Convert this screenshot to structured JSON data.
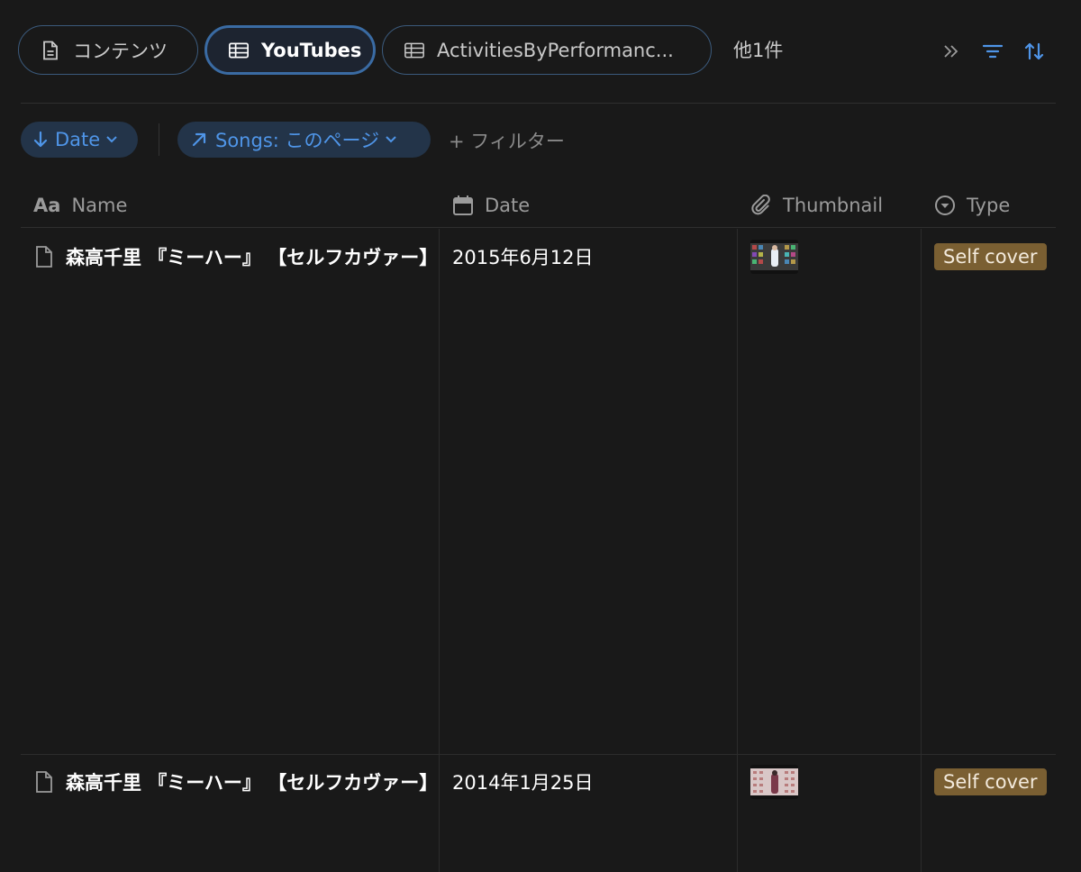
{
  "tabs": [
    {
      "label": "コンテンツ",
      "icon": "document-icon",
      "active": false
    },
    {
      "label": "YouTubes",
      "icon": "table-icon",
      "active": true
    },
    {
      "label": "ActivitiesByPerformanc...",
      "icon": "table-icon",
      "active": false
    }
  ],
  "tabs_more": "他1件",
  "toolbar": {
    "expand_icon": "double-chevron-right-icon",
    "filter_icon": "filter-lines-icon",
    "sort_icon": "sort-arrows-icon"
  },
  "filters": {
    "sort_chip": "Date",
    "relation_chip": "Songs: このページ",
    "add_filter": "+ フィルター"
  },
  "columns": {
    "name": "Name",
    "date": "Date",
    "thumbnail": "Thumbnail",
    "type": "Type"
  },
  "rows": [
    {
      "name": "森高千里 『ミーハー』 【セルフカヴァー】",
      "date": "2015年6月12日",
      "type": "Self cover"
    },
    {
      "name": "森高千里 『ミーハー』 【セルフカヴァー】",
      "date": "2014年1月25日",
      "type": "Self cover"
    }
  ],
  "colors": {
    "accent": "#4f95e8",
    "badge": "#7a5f32",
    "background": "#191919"
  }
}
